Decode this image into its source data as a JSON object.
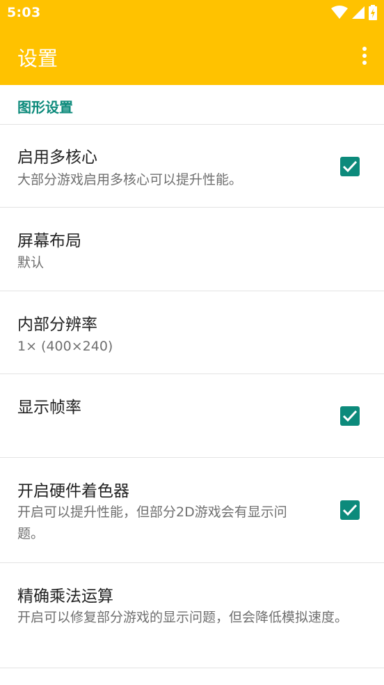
{
  "status_bar": {
    "time": "5:03",
    "icons": [
      "wifi-icon",
      "signal-icon",
      "battery-charging-icon"
    ]
  },
  "app_bar": {
    "title": "设置",
    "menu_icon": "more-vert-icon"
  },
  "colors": {
    "primary": "#FFC200",
    "accent": "#0C8A7B",
    "divider": "#e3e3e3",
    "summary_text": "#6f6f6f"
  },
  "section": {
    "label": "图形设置"
  },
  "prefs": [
    {
      "title": "启用多核心",
      "summary": "大部分游戏启用多核心可以提升性能。",
      "checked": true
    },
    {
      "title": "屏幕布局",
      "summary": "默认"
    },
    {
      "title": "内部分辨率",
      "summary": "1× (400×240)"
    },
    {
      "title": "显示帧率",
      "summary": "",
      "checked": true
    },
    {
      "title": "开启硬件着色器",
      "summary": "开启可以提升性能，但部分2D游戏会有显示问题。",
      "checked": true
    },
    {
      "title": "精确乘法运算",
      "summary": "开启可以修复部分游戏的显示问题，但会降低模拟速度。"
    }
  ]
}
